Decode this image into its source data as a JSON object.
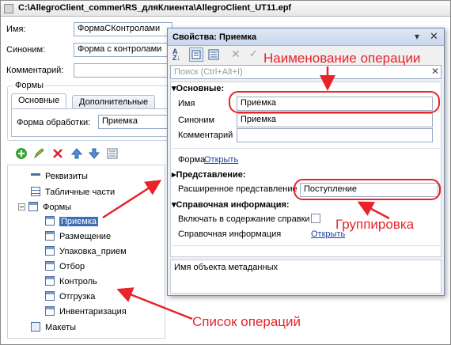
{
  "window": {
    "title": "C:\\AllegroClient_commer\\RS_дляКлиента\\AllegroClient_UT11.epf"
  },
  "main": {
    "name_label": "Имя:",
    "name_value": "ФормаСКонтролами",
    "synonym_label": "Синоним:",
    "synonym_value": "Форма с контролами",
    "comment_label": "Комментарий:",
    "forms_group_label": "Формы",
    "tabs": [
      "Основные",
      "Дополнительные"
    ],
    "processing_form_label": "Форма обработки:",
    "processing_form_value": "Приемка"
  },
  "tree": {
    "items": [
      {
        "label": "Реквизиты",
        "icon": "attributes-icon"
      },
      {
        "label": "Табличные части",
        "icon": "table-icon"
      },
      {
        "label": "Формы",
        "icon": "forms-icon"
      },
      {
        "label": "Макеты",
        "icon": "template-icon"
      }
    ],
    "forms": [
      "Приемка",
      "Размещение",
      "Упаковка_прием",
      "Отбор",
      "Контроль",
      "Отгрузка",
      "Инвентаризация"
    ]
  },
  "props": {
    "title": "Свойства: Приемка",
    "search_placeholder": "Поиск (Ctrl+Alt+I)",
    "section_main": "Основные:",
    "name_label": "Имя",
    "name_value": "Приемка",
    "synonym_label": "Синоним",
    "synonym_value": "Приемка",
    "comment_label": "Комментарий",
    "form_label": "Форма",
    "open_link": "Открыть",
    "section_view": "Представление:",
    "ext_repr_label": "Расширенное представление",
    "ext_repr_value": "Поступление",
    "section_help": "Справочная информация:",
    "include_help_label": "Включать в содержание справки",
    "help_info_label": "Справочная информация",
    "help_open_link": "Открыть",
    "description": "Имя объекта метаданных"
  },
  "annotations": {
    "operation_name": "Наименование операции",
    "grouping": "Группировка",
    "operations_list": "Список операций"
  },
  "colors": {
    "annotation": "#e8232a",
    "link": "#1a3f9c"
  }
}
